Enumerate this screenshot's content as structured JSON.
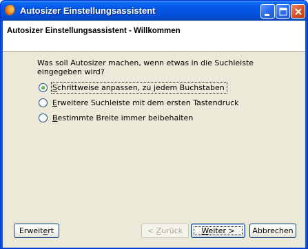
{
  "window": {
    "title": "Autosizer Einstellungsassistent"
  },
  "header": {
    "title": "Autosizer Einstellungsassistent - Willkommen"
  },
  "content": {
    "question": "Was soll Autosizer machen, wenn etwas in die Suchleiste eingegeben wird?",
    "options": [
      {
        "accel": "S",
        "rest": "chrittweise anpassen, zu jedem Buchstaben",
        "checked": true
      },
      {
        "accel": "E",
        "rest": "rweitere Suchleiste mit dem ersten Tastendruck",
        "checked": false
      },
      {
        "accel": "B",
        "rest": "estimmte Breite immer beibehalten",
        "checked": false
      }
    ]
  },
  "buttons": {
    "advanced": {
      "pre": "Erweit",
      "accel": "e",
      "post": "rt"
    },
    "back": {
      "pre": "< ",
      "accel": "Z",
      "post": "urück"
    },
    "next": {
      "pre": "",
      "accel": "W",
      "post": "eiter >"
    },
    "cancel": {
      "label": "Abbrechen"
    }
  }
}
